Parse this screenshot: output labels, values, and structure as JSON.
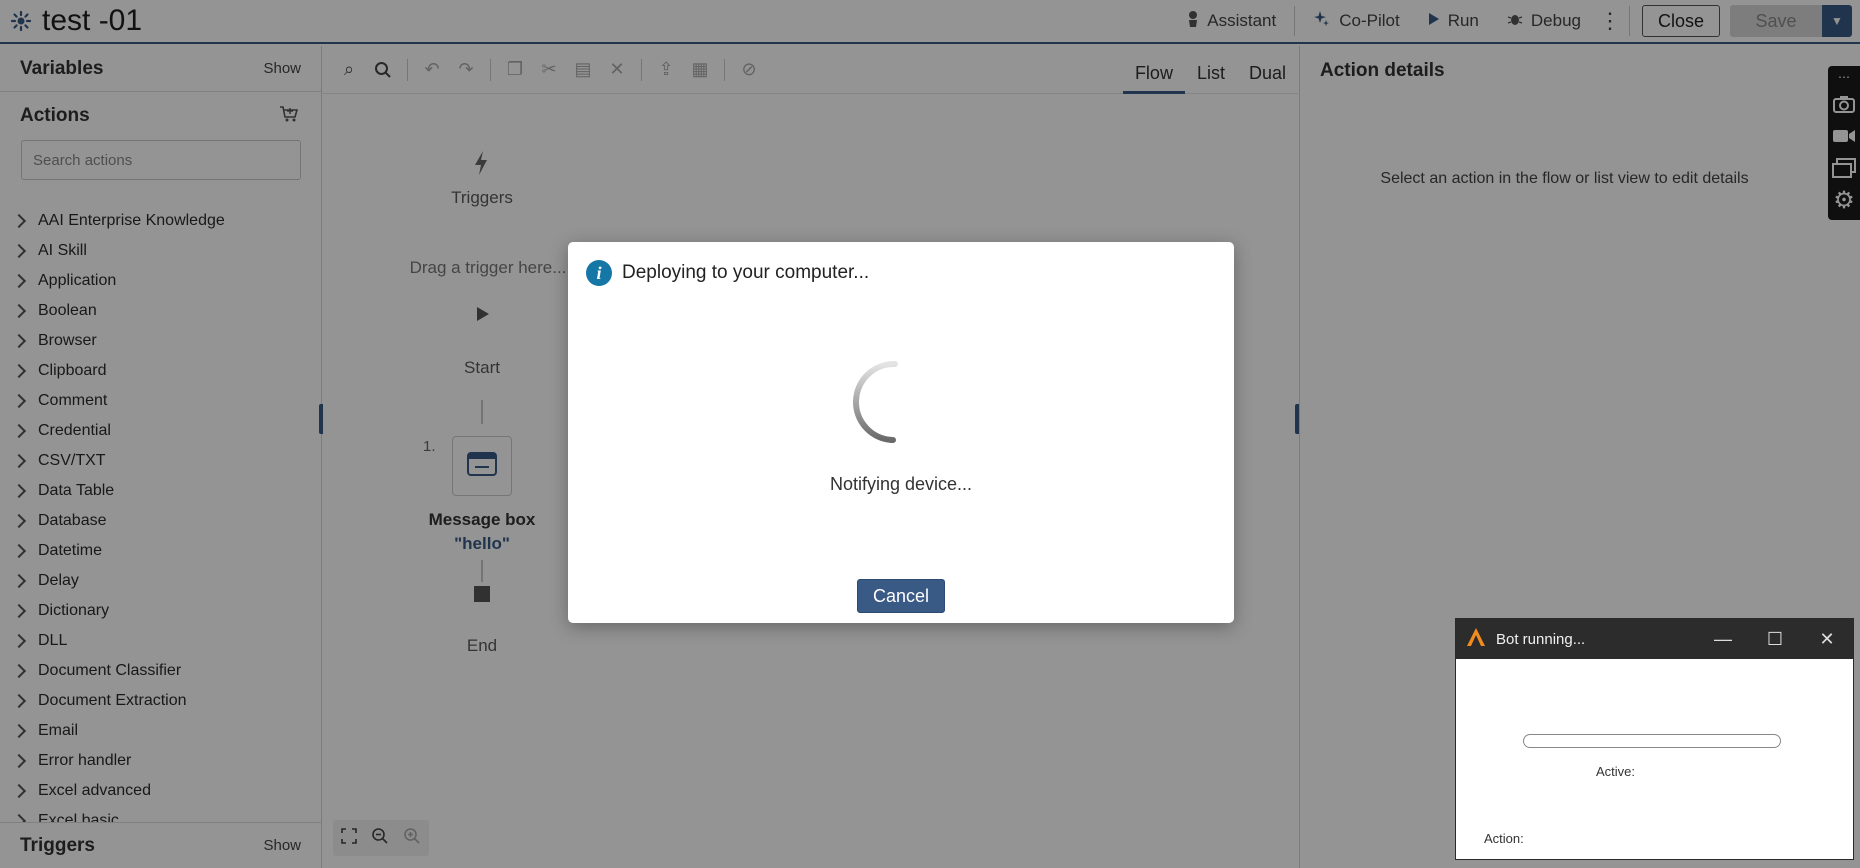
{
  "app": {
    "title": "test -01"
  },
  "topbar": {
    "assistant": "Assistant",
    "copilot": "Co-Pilot",
    "run": "Run",
    "debug": "Debug",
    "close": "Close",
    "save": "Save"
  },
  "sidebar": {
    "variables_title": "Variables",
    "variables_show": "Show",
    "actions_title": "Actions",
    "search_placeholder": "Search actions",
    "actions": [
      "AAI Enterprise Knowledge",
      "AI Skill",
      "Application",
      "Boolean",
      "Browser",
      "Clipboard",
      "Comment",
      "Credential",
      "CSV/TXT",
      "Data Table",
      "Database",
      "Datetime",
      "Delay",
      "Dictionary",
      "DLL",
      "Document Classifier",
      "Document Extraction",
      "Email",
      "Error handler",
      "Excel advanced",
      "Excel basic"
    ],
    "triggers_title": "Triggers",
    "triggers_show": "Show"
  },
  "canvas": {
    "tabs": [
      "Flow",
      "List",
      "Dual"
    ],
    "active_tab": "Flow",
    "triggers_label": "Triggers",
    "drag_hint": "Drag a trigger here...",
    "start_label": "Start",
    "step_number": "1.",
    "step_title": "Message box",
    "step_value": "\"hello\"",
    "end_label": "End"
  },
  "details": {
    "title": "Action details",
    "hint": "Select an action in the flow or list view to edit details"
  },
  "modal": {
    "title": "Deploying to your computer...",
    "status": "Notifying device...",
    "cancel": "Cancel"
  },
  "bot_window": {
    "title": "Bot running...",
    "active_label": "Active:",
    "action_label": "Action:",
    "progress": 0
  },
  "colors": {
    "accent": "#3a5a86",
    "info": "#1577a6"
  }
}
